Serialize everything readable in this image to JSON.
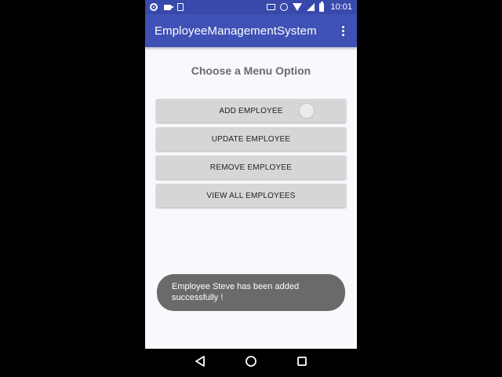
{
  "status_bar": {
    "time": "10:01",
    "left_icons": [
      "record-icon",
      "camera-icon",
      "document-icon"
    ],
    "right_icons": [
      "cast-icon",
      "alarm-icon",
      "wifi-icon",
      "signal-icon",
      "battery-icon"
    ]
  },
  "app_bar": {
    "title": "EmployeeManagementSystem",
    "overflow_icon": "more-vertical-icon"
  },
  "main": {
    "heading": "Choose a Menu Option",
    "buttons": [
      {
        "label": "ADD EMPLOYEE"
      },
      {
        "label": "UPDATE EMPLOYEE"
      },
      {
        "label": "REMOVE EMPLOYEE"
      },
      {
        "label": "VIEW ALL EMPLOYEES"
      }
    ]
  },
  "toast": {
    "message": "Employee Steve has been added successfully !"
  },
  "nav_bar": {
    "icons": [
      "back-icon",
      "home-icon",
      "recent-apps-icon"
    ]
  },
  "colors": {
    "app_bar": "#3f51b5",
    "status_bar": "#3949ab",
    "background": "#faf8fc",
    "button": "#d6d6d6",
    "toast": "#6a6a6a"
  }
}
